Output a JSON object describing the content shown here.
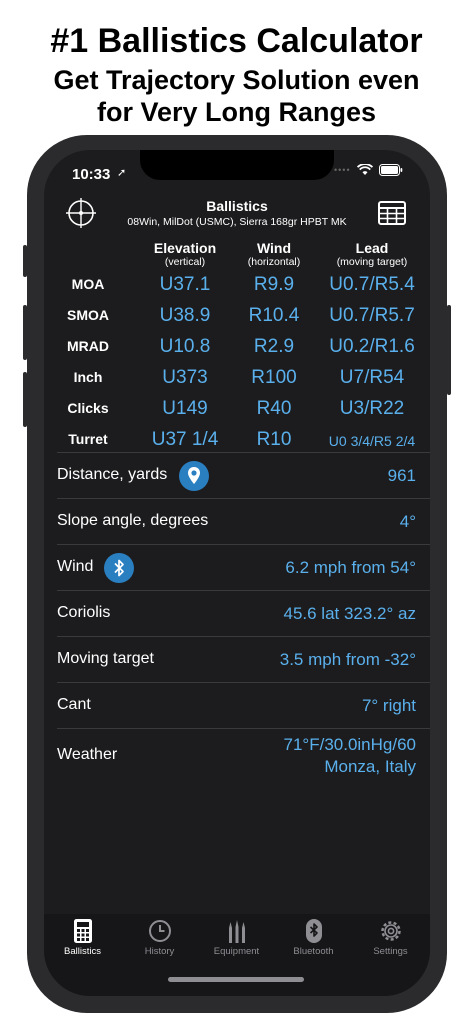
{
  "promo": {
    "headline": "#1 Ballistics Calculator",
    "subline1": "Get Trajectory Solution even",
    "subline2": "for Very Long Ranges"
  },
  "status": {
    "time": "10:33",
    "location_arrow": "➚"
  },
  "header": {
    "title": "Ballistics",
    "subtitle": "08Win, MilDot (USMC), Sierra 168gr HPBT MK"
  },
  "columns": [
    {
      "label": "Elevation",
      "sub": "(vertical)"
    },
    {
      "label": "Wind",
      "sub": "(horizontal)"
    },
    {
      "label": "Lead",
      "sub": "(moving target)"
    }
  ],
  "rows": [
    {
      "label": "MOA",
      "elevation": "U37.1",
      "wind": "R9.9",
      "lead": "U0.7/R5.4"
    },
    {
      "label": "SMOA",
      "elevation": "U38.9",
      "wind": "R10.4",
      "lead": "U0.7/R5.7"
    },
    {
      "label": "MRAD",
      "elevation": "U10.8",
      "wind": "R2.9",
      "lead": "U0.2/R1.6"
    },
    {
      "label": "Inch",
      "elevation": "U373",
      "wind": "R100",
      "lead": "U7/R54"
    },
    {
      "label": "Clicks",
      "elevation": "U149",
      "wind": "R40",
      "lead": "U3/R22"
    },
    {
      "label": "Turret",
      "elevation": "U37 1/4",
      "wind": "R10",
      "lead": "U0 3/4/R5 2/4"
    }
  ],
  "settings": {
    "distance": {
      "label": "Distance, yards",
      "value": "961"
    },
    "slope": {
      "label": "Slope angle, degrees",
      "value": "4°"
    },
    "wind": {
      "label": "Wind",
      "value": "6.2 mph from 54°"
    },
    "coriolis": {
      "label": "Coriolis",
      "value": "45.6 lat 323.2° az"
    },
    "moving": {
      "label": "Moving target",
      "value": "3.5 mph from -32°"
    },
    "cant": {
      "label": "Cant",
      "value": "7° right"
    },
    "weather": {
      "label": "Weather",
      "value_line1": "71°F/30.0inHg/60",
      "value_line2": "Monza, Italy"
    }
  },
  "tabs": [
    {
      "label": "Ballistics",
      "icon": "calculator-icon",
      "active": true
    },
    {
      "label": "History",
      "icon": "clock-icon",
      "active": false
    },
    {
      "label": "Equipment",
      "icon": "bullets-icon",
      "active": false
    },
    {
      "label": "Bluetooth",
      "icon": "bluetooth-icon",
      "active": false
    },
    {
      "label": "Settings",
      "icon": "gear-icon",
      "active": false
    }
  ],
  "colors": {
    "accent": "#5ab0ec",
    "badge": "#2a7fc1",
    "background": "#1c1c1e"
  }
}
